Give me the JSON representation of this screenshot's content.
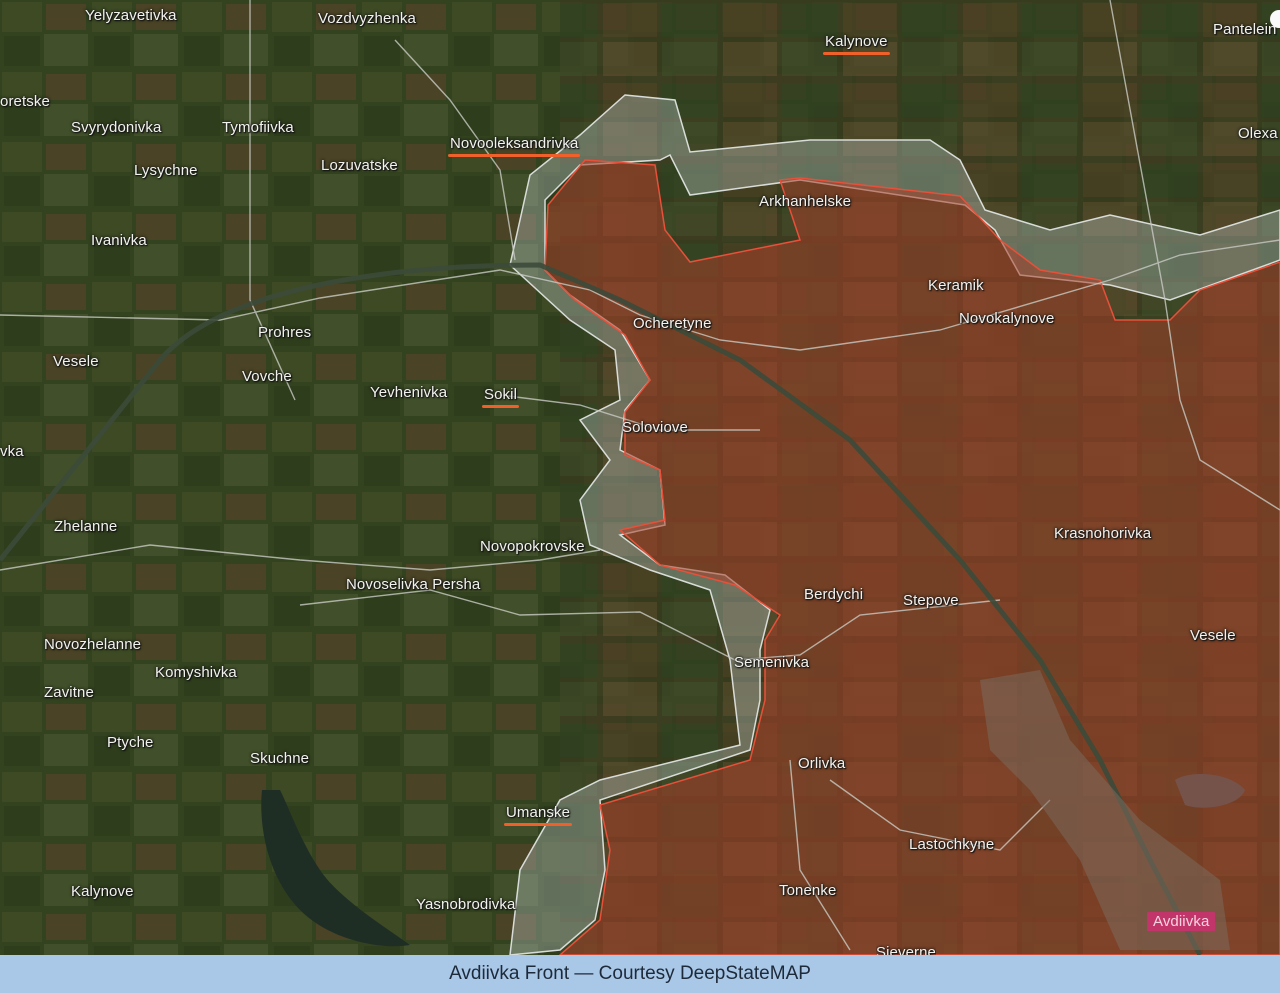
{
  "caption": "Avdiivka Front — Courtesy DeepStateMAP",
  "colors": {
    "occupied": "#a8402a",
    "contested": "#b9c3bf",
    "frontline": "#e8503a",
    "highlight": "#f0602a",
    "city_badge": "#c2356a",
    "caption_bar": "#a9c7e6"
  },
  "places": {
    "yelyzavetivka": "Yelyzavetivka",
    "vozdvyzhenka": "Vozdvyzhenka",
    "kalynove_n": "Kalynove",
    "panteleimonivka": "Pantelein",
    "oretske": "oretske",
    "svyrydonivka": "Svyrydonivka",
    "tymofiivka": "Tymofiivka",
    "novooleksandrivka": "Novooleksandrivka",
    "olexa": "Olexa",
    "lysychne": "Lysychne",
    "lozuvatske": "Lozuvatske",
    "arkhanhelske": "Arkhanhelske",
    "ivanivka": "Ivanivka",
    "keramik": "Keramik",
    "ocheretyne": "Ocheretyne",
    "novokalynove": "Novokalynove",
    "prohres": "Prohres",
    "vesele_w": "Vesele",
    "vovche": "Vovche",
    "yevhenivka": "Yevhenivka",
    "sokil": "Sokil",
    "soloviove": "Soloviove",
    "vka": "vka",
    "zhelanne": "Zhelanne",
    "novopokrovske": "Novopokrovske",
    "krasnohorivka": "Krasnohorivka",
    "novoselivka_persha": "Novoselivka Persha",
    "berdychi": "Berdychi",
    "stepove": "Stepove",
    "novozhelanne": "Novozhelanne",
    "vesele_e": "Vesele",
    "semenivka": "Semenivka",
    "komyshivka": "Komyshivka",
    "zavitne": "Zavitne",
    "ptyche": "Ptyche",
    "skuchne": "Skuchne",
    "orlivka": "Orlivka",
    "umanske": "Umanske",
    "lastochkyne": "Lastochkyne",
    "kalynove_s": "Kalynove",
    "tonenke": "Tonenke",
    "yasnobrodivka": "Yasnobrodivka",
    "avdiivka": "Avdiivka",
    "sieverne": "Sieverne"
  },
  "highlighted_places": [
    "Kalynove",
    "Novooleksandrivka",
    "Sokil",
    "Umanske"
  ]
}
